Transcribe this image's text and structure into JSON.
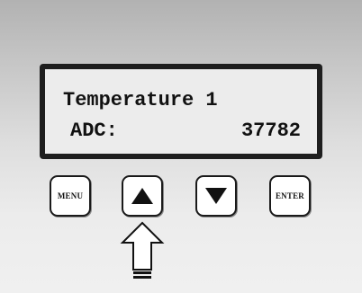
{
  "display": {
    "line1": "Temperature 1",
    "adc_label": "ADC:",
    "adc_value": "37782"
  },
  "buttons": {
    "menu_label": "MENU",
    "up_icon": "triangle-up-icon",
    "down_icon": "triangle-down-icon",
    "enter_label": "ENTER"
  },
  "indicator": {
    "icon": "arrow-up-outline-icon",
    "points_to": "up"
  },
  "colors": {
    "background_top": "#b2b2b2",
    "background_bottom": "#f0f0f0",
    "lcd_bezel": "#1e1e1e",
    "lcd_screen": "#ececec",
    "text": "#111111",
    "button_face": "#ffffff"
  }
}
